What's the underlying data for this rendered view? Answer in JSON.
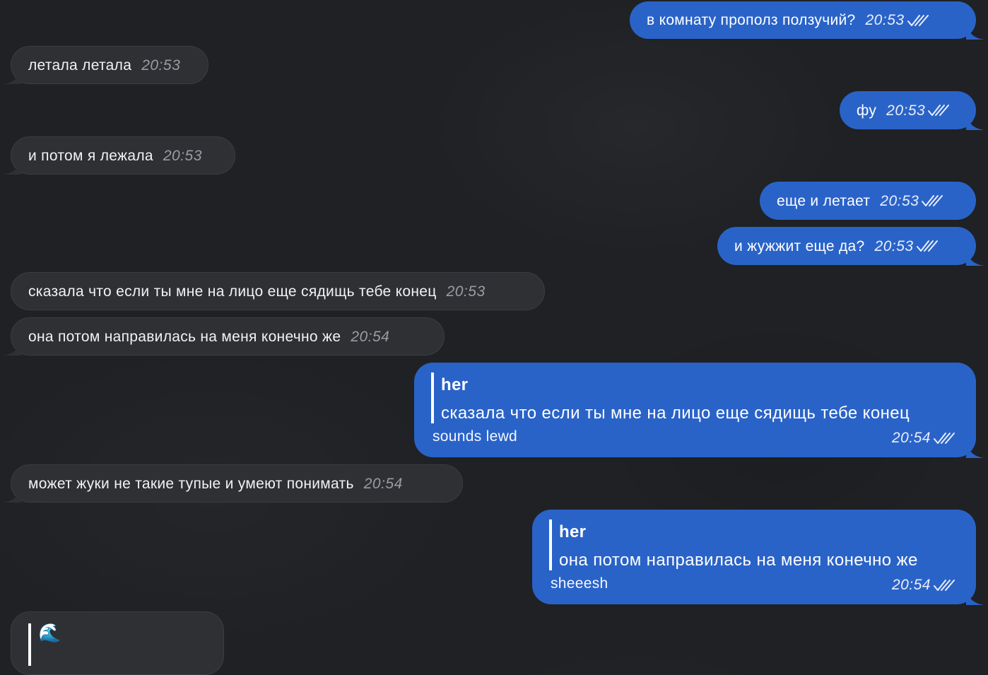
{
  "messages": [
    {
      "text": "в комнату прополз ползучий?",
      "time": "20:53"
    },
    {
      "text": "летала летала",
      "time": "20:53"
    },
    {
      "text": "фу",
      "time": "20:53"
    },
    {
      "text": "и потом я лежала",
      "time": "20:53"
    },
    {
      "text": "еще и летает",
      "time": "20:53"
    },
    {
      "text": "и жужжит еще да?",
      "time": "20:53"
    },
    {
      "text": "сказала что если ты мне на лицо еще сядищь тебе конец",
      "time": "20:53"
    },
    {
      "text": "она потом направилась на меня конечно же",
      "time": "20:54"
    },
    {
      "quote_author": "her",
      "quote_text": "сказала что если ты мне на лицо еще сядищь тебе конец",
      "text": "sounds lewd",
      "time": "20:54"
    },
    {
      "text": "может жуки не такие тупые и умеют понимать",
      "time": "20:54"
    },
    {
      "quote_author": "her",
      "quote_text": "она потом направилась на меня конечно же",
      "text": "sheeesh",
      "time": "20:54"
    },
    {
      "quote_emoji": "🌊"
    }
  ],
  "colors": {
    "background": "#1f2124",
    "incoming": "#2e3034",
    "outgoing": "#2a63c8"
  },
  "icons": {
    "read_status": "double-check-icon"
  }
}
